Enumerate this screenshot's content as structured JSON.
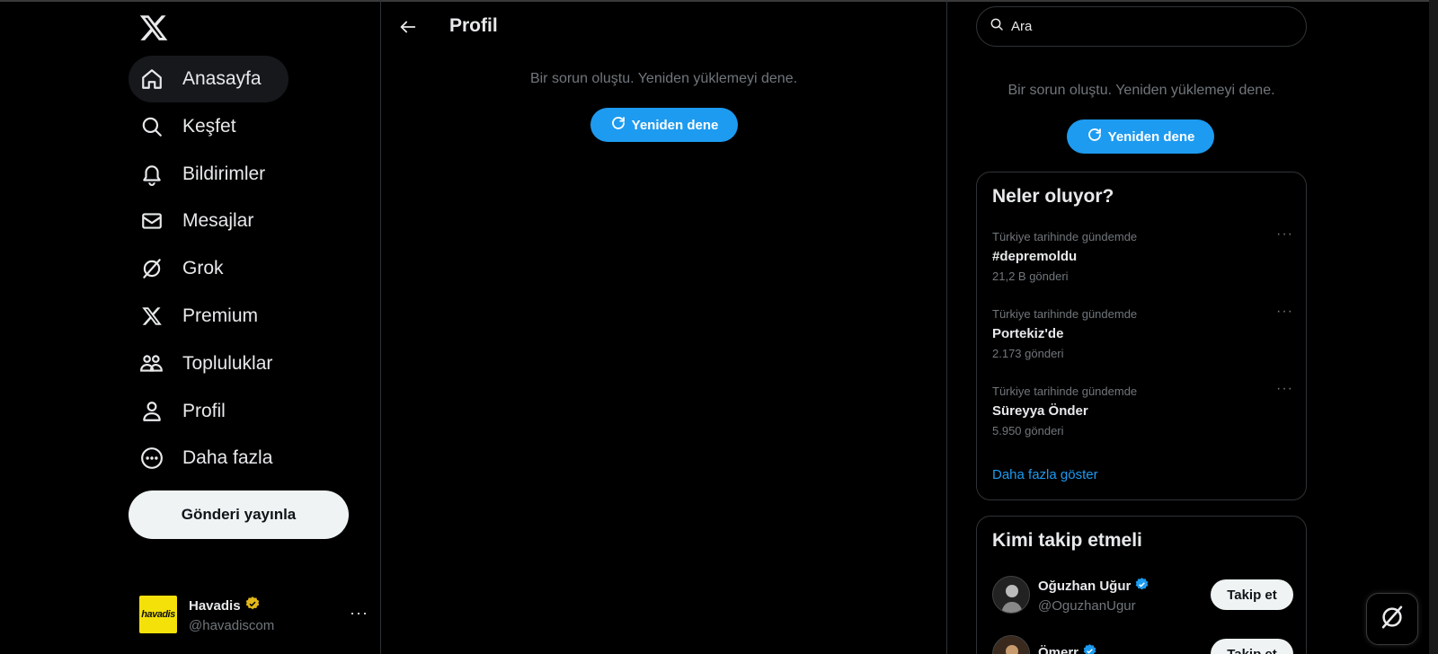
{
  "sidebar": {
    "items": [
      {
        "label": "Anasayfa",
        "icon": "home-icon"
      },
      {
        "label": "Keşfet",
        "icon": "search-icon"
      },
      {
        "label": "Bildirimler",
        "icon": "bell-icon"
      },
      {
        "label": "Mesajlar",
        "icon": "mail-icon"
      },
      {
        "label": "Grok",
        "icon": "grok-icon"
      },
      {
        "label": "Premium",
        "icon": "x-logo-icon"
      },
      {
        "label": "Topluluklar",
        "icon": "communities-icon"
      },
      {
        "label": "Profil",
        "icon": "person-icon"
      },
      {
        "label": "Daha fazla",
        "icon": "more-circle-icon"
      }
    ],
    "post_button": "Gönderi yayınla",
    "account": {
      "avatar_text": "havadis",
      "name": "Havadis",
      "handle": "@havadiscom",
      "more": "···"
    }
  },
  "main": {
    "title": "Profil",
    "error_text": "Bir sorun oluştu. Yeniden yüklemeyi dene.",
    "retry_label": "Yeniden dene"
  },
  "right": {
    "search_text": "Ara",
    "error_text": "Bir sorun oluştu. Yeniden yüklemeyi dene.",
    "retry_label": "Yeniden dene",
    "trends": {
      "title": "Neler oluyor?",
      "items": [
        {
          "context": "Türkiye tarihinde gündemde",
          "name": "#depremoldu",
          "count": "21,2 B gönderi"
        },
        {
          "context": "Türkiye tarihinde gündemde",
          "name": "Portekiz'de",
          "count": "2.173 gönderi"
        },
        {
          "context": "Türkiye tarihinde gündemde",
          "name": "Süreyya Önder",
          "count": "5.950 gönderi"
        }
      ],
      "show_more": "Daha fazla göster",
      "more": "···"
    },
    "who_to_follow": {
      "title": "Kimi takip etmeli",
      "items": [
        {
          "name": "Oğuzhan Uğur",
          "handle": "@OguzhanUgur",
          "button": "Takip et"
        },
        {
          "name": "Ömerr",
          "handle": "",
          "button": "Takip et"
        }
      ]
    }
  },
  "colors": {
    "background": "#000000",
    "accent": "#1d9bf0",
    "text_primary": "#e7e9ea",
    "text_secondary": "#71767b",
    "border": "#2f3336",
    "verified_gold": "#e2b719"
  }
}
